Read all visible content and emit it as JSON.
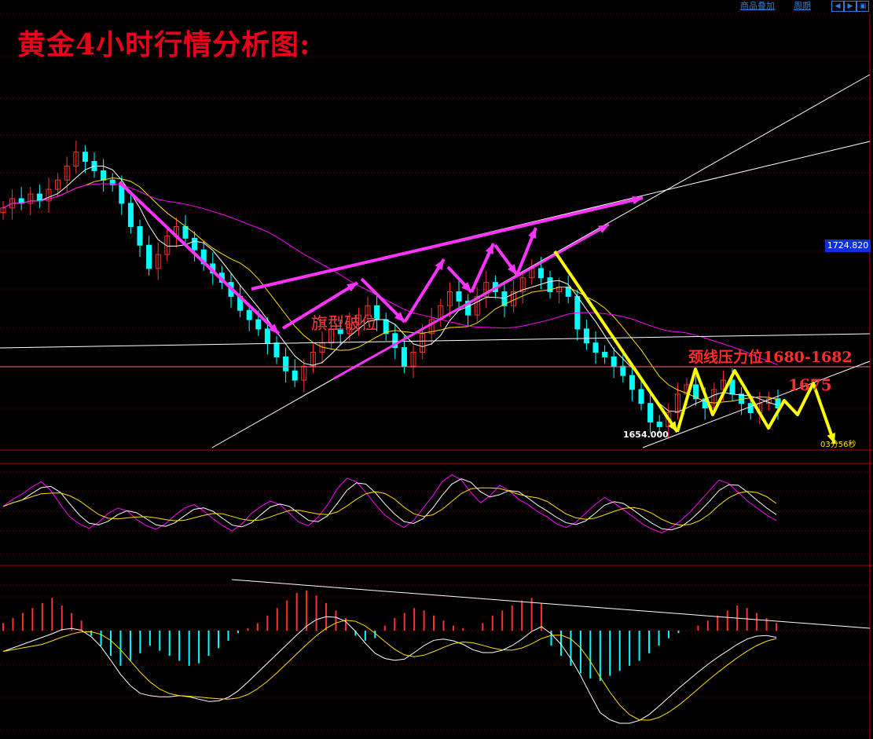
{
  "title": "黄金4小时行情分析图:",
  "toolbar": {
    "overlay_label": "商品叠加",
    "period_label": "周期"
  },
  "labels": {
    "current_price": "1724.820",
    "low_price": "1654.000",
    "flag_break": "旗型破位",
    "neckline": "颈线压力位1680-1682",
    "target": "1675",
    "countdown": "03分56秒"
  },
  "colors": {
    "bull_candle": "#ff3030",
    "bear_candle": "#00ffff",
    "ma_short": "#ffffff",
    "ma_mid": "#ffe000",
    "ma_long": "#ff00ff",
    "arrow_magenta": "#ff33ff",
    "arrow_yellow": "#ffff00",
    "grid": "#8a0000"
  },
  "chart_data": [
    {
      "type": "candlestick",
      "title": "黄金4小时行情分析图:",
      "current_price": 1724.82,
      "marked_low": 1654.0,
      "neckline_resistance": [
        1680,
        1682
      ],
      "target": 1675,
      "annotations": [
        "旗型破位",
        "颈线压力位1680-1682",
        "1675"
      ],
      "closes": [
        1748,
        1752,
        1750,
        1754,
        1751,
        1756,
        1760,
        1766,
        1772,
        1768,
        1764,
        1760,
        1758,
        1750,
        1740,
        1732,
        1722,
        1728,
        1736,
        1740,
        1735,
        1730,
        1724,
        1720,
        1716,
        1710,
        1704,
        1700,
        1696,
        1690,
        1684,
        1678,
        1674,
        1680,
        1686,
        1690,
        1696,
        1694,
        1698,
        1702,
        1706,
        1700,
        1694,
        1688,
        1680,
        1686,
        1694,
        1700,
        1706,
        1712,
        1708,
        1702,
        1710,
        1716,
        1712,
        1706,
        1712,
        1718,
        1722,
        1718,
        1712,
        1714,
        1710,
        1696,
        1690,
        1686,
        1684,
        1680,
        1676,
        1670,
        1664,
        1656,
        1654,
        1660,
        1668,
        1672,
        1666,
        1662,
        1670,
        1674,
        1668,
        1664,
        1660,
        1664,
        1666,
        1662
      ],
      "series": [
        {
          "name": "",
          "kind": "ma_short"
        },
        {
          "name": "",
          "kind": "ma_mid"
        },
        {
          "name": "",
          "kind": "ma_long"
        }
      ]
    },
    {
      "type": "line",
      "panel": "oscillator",
      "series": [
        {
          "name": "",
          "values": [
            60,
            68,
            74,
            82,
            88,
            78,
            62,
            48,
            40,
            35,
            42,
            52,
            58,
            55,
            45,
            38,
            34,
            40,
            50,
            58,
            62,
            55,
            46,
            38,
            32,
            40,
            52,
            60,
            66,
            62,
            52,
            42,
            38,
            48,
            62,
            80,
            92,
            88,
            76,
            62,
            50,
            42,
            36,
            44,
            58,
            72,
            88,
            96,
            90,
            76,
            64,
            72,
            84,
            78,
            68,
            62,
            54,
            48,
            40,
            36,
            42,
            52,
            62,
            70,
            64,
            56,
            48,
            40,
            34,
            30,
            36,
            44,
            54,
            66,
            78,
            90,
            86,
            76,
            66,
            58,
            50,
            44
          ]
        }
      ]
    },
    {
      "type": "bar",
      "panel": "macd",
      "values": [
        3,
        5,
        7,
        9,
        11,
        13,
        10,
        7,
        4,
        -2,
        -6,
        -10,
        -14,
        -12,
        -9,
        -6,
        -8,
        -10,
        -12,
        -14,
        -13,
        -10,
        -7,
        -4,
        -1,
        1,
        3,
        6,
        9,
        12,
        15,
        16,
        14,
        11,
        8,
        5,
        -2,
        -4,
        -3,
        2,
        5,
        7,
        9,
        8,
        6,
        4,
        2,
        1,
        0,
        3,
        6,
        8,
        10,
        12,
        13,
        11,
        -6,
        -10,
        -14,
        -17,
        -19,
        -20,
        -18,
        -16,
        -14,
        -12,
        -9,
        -6,
        -3,
        -1,
        0,
        2,
        4,
        6,
        8,
        10,
        9,
        7,
        5,
        3
      ]
    }
  ]
}
